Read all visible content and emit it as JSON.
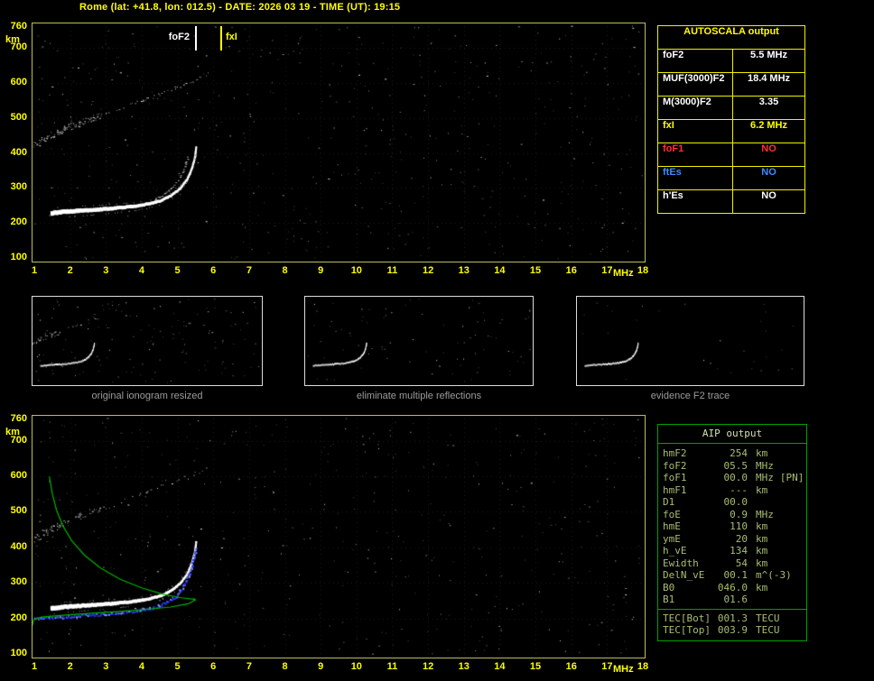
{
  "header": {
    "title": "Rome (lat: +41.8, lon: 012.5) - DATE: 2026 03 19 - TIME (UT): 19:15"
  },
  "colors": {
    "accent_yellow": "#ffff00",
    "plot_border": "#bdbd5a",
    "white": "#ffffff",
    "red": "#ff3030",
    "blue": "#3d8bff",
    "green": "#00b400",
    "aip_text": "#a9bd72",
    "caption_gray": "#9c9c9c"
  },
  "top_plot": {
    "y_unit": "km",
    "x_unit": "MHz",
    "y_ticks": [
      "760",
      "700",
      "600",
      "500",
      "400",
      "300",
      "200",
      "100"
    ],
    "x_ticks": [
      "1",
      "2",
      "3",
      "4",
      "5",
      "6",
      "7",
      "8",
      "9",
      "10",
      "11",
      "12",
      "13",
      "14",
      "15",
      "16",
      "17",
      "18"
    ],
    "markers": [
      {
        "label": "foF2",
        "freq": 5.5,
        "color": "#ffffff"
      },
      {
        "label": "fxI",
        "freq": 6.2,
        "color": "#ffff00"
      }
    ]
  },
  "bottom_plot": {
    "y_unit": "km",
    "x_unit": "MHz",
    "y_ticks": [
      "760",
      "700",
      "600",
      "500",
      "400",
      "300",
      "200",
      "100"
    ],
    "x_ticks": [
      "1",
      "2",
      "3",
      "4",
      "5",
      "6",
      "7",
      "8",
      "9",
      "10",
      "11",
      "12",
      "13",
      "14",
      "15",
      "16",
      "17",
      "18"
    ]
  },
  "autoscala": {
    "title": "AUTOSCALA output",
    "rows": [
      {
        "param": "foF2",
        "value": "5.5 MHz",
        "color": "#ffffff"
      },
      {
        "param": "MUF(3000)F2",
        "value": "18.4 MHz",
        "color": "#ffffff"
      },
      {
        "param": "M(3000)F2",
        "value": "3.35",
        "color": "#ffffff"
      },
      {
        "param": "fxI",
        "value": "6.2 MHz",
        "color": "#ffff00"
      },
      {
        "param": "foF1",
        "value": "NO",
        "color": "#ff3030"
      },
      {
        "param": "ftEs",
        "value": "NO",
        "color": "#3d8bff"
      },
      {
        "param": "h'Es",
        "value": "NO",
        "color": "#ffffff"
      }
    ]
  },
  "thumbnails": [
    {
      "caption": "original ionogram resized"
    },
    {
      "caption": "eliminate multiple reflections"
    },
    {
      "caption": "evidence F2 trace"
    }
  ],
  "aip": {
    "title": "AIP output",
    "rows": [
      {
        "param": "hmF2",
        "value": "254",
        "unit": "km"
      },
      {
        "param": "foF2",
        "value": "05.5",
        "unit": "MHz"
      },
      {
        "param": "foF1",
        "value": "00.0",
        "unit": "MHz",
        "note": "[PN]"
      },
      {
        "param": "hmF1",
        "value": "---",
        "unit": "km"
      },
      {
        "param": "D1",
        "value": "00.0",
        "unit": ""
      },
      {
        "param": "foE",
        "value": "0.9",
        "unit": "MHz"
      },
      {
        "param": "hmE",
        "value": "110",
        "unit": "km"
      },
      {
        "param": "ymE",
        "value": "20",
        "unit": "km"
      },
      {
        "param": "h_vE",
        "value": "134",
        "unit": "km"
      },
      {
        "param": "Ewidth",
        "value": "54",
        "unit": "km"
      },
      {
        "param": "DelN_vE",
        "value": "00.1",
        "unit": "m^(-3)"
      },
      {
        "param": "B0",
        "value": "046.0",
        "unit": "km"
      },
      {
        "param": "B1",
        "value": "01.6",
        "unit": ""
      }
    ],
    "tec_rows": [
      {
        "param": "TEC[Bot]",
        "value": "001.3",
        "unit": "TECU"
      },
      {
        "param": "TEC[Top]",
        "value": "003.9",
        "unit": "TECU"
      }
    ]
  },
  "chart_data": [
    {
      "id": "top_ionogram",
      "type": "scatter",
      "title": "ionogram with AUTOSCALA markers",
      "xlabel": "MHz",
      "ylabel": "km",
      "xlim": [
        1,
        18
      ],
      "ylim": [
        100,
        760
      ],
      "grid": true,
      "annotations": [
        {
          "label": "foF2",
          "x": 5.5
        },
        {
          "label": "fxI",
          "x": 6.2
        }
      ],
      "series": [
        {
          "name": "F2_trace",
          "points": [
            [
              1.45,
              228
            ],
            [
              1.8,
              232
            ],
            [
              2.2,
              235
            ],
            [
              2.7,
              238
            ],
            [
              3.2,
              242
            ],
            [
              3.7,
              247
            ],
            [
              4.1,
              253
            ],
            [
              4.5,
              263
            ],
            [
              4.8,
              278
            ],
            [
              5.05,
              298
            ],
            [
              5.25,
              325
            ],
            [
              5.38,
              355
            ],
            [
              5.47,
              390
            ],
            [
              5.5,
              418
            ]
          ]
        },
        {
          "name": "second_reflection_band",
          "points": [
            [
              1.0,
              425
            ],
            [
              1.4,
              448
            ],
            [
              1.9,
              472
            ],
            [
              2.4,
              492
            ],
            [
              2.9,
              510
            ],
            [
              3.4,
              528
            ],
            [
              3.9,
              547
            ],
            [
              4.4,
              566
            ],
            [
              4.9,
              584
            ],
            [
              5.3,
              600
            ],
            [
              5.65,
              615
            ],
            [
              5.85,
              628
            ]
          ]
        },
        {
          "name": "x_mode_branch",
          "points": [
            [
              4.35,
              268
            ],
            [
              4.65,
              285
            ],
            [
              4.9,
              307
            ],
            [
              5.08,
              333
            ],
            [
              5.2,
              362
            ],
            [
              5.3,
              395
            ]
          ]
        }
      ]
    },
    {
      "id": "bottom_ionogram_profile",
      "type": "line",
      "title": "ionogram with restored trace and electron density profile",
      "xlabel": "MHz",
      "ylabel": "km",
      "xlim": [
        1,
        18
      ],
      "ylim": [
        100,
        760
      ],
      "grid": true,
      "series": [
        {
          "name": "F2_trace",
          "points": [
            [
              1.45,
              228
            ],
            [
              1.8,
              232
            ],
            [
              2.2,
              235
            ],
            [
              2.7,
              238
            ],
            [
              3.2,
              242
            ],
            [
              3.7,
              247
            ],
            [
              4.1,
              253
            ],
            [
              4.5,
              263
            ],
            [
              4.8,
              278
            ],
            [
              5.05,
              298
            ],
            [
              5.25,
              325
            ],
            [
              5.38,
              355
            ],
            [
              5.47,
              390
            ],
            [
              5.5,
              418
            ]
          ]
        },
        {
          "name": "second_reflection_band",
          "points": [
            [
              1.0,
              425
            ],
            [
              1.4,
              448
            ],
            [
              1.9,
              472
            ],
            [
              2.4,
              492
            ],
            [
              2.9,
              510
            ],
            [
              3.4,
              528
            ],
            [
              3.9,
              547
            ],
            [
              4.4,
              566
            ],
            [
              4.9,
              584
            ],
            [
              5.3,
              600
            ],
            [
              5.65,
              615
            ],
            [
              5.85,
              628
            ]
          ]
        },
        {
          "name": "restored_trace_blue",
          "points": [
            [
              1.0,
              202
            ],
            [
              1.5,
              204
            ],
            [
              2.0,
              207
            ],
            [
              2.5,
              210
            ],
            [
              3.0,
              214
            ],
            [
              3.5,
              218
            ],
            [
              3.9,
              224
            ],
            [
              4.3,
              232
            ],
            [
              4.65,
              245
            ],
            [
              4.95,
              265
            ],
            [
              5.18,
              295
            ],
            [
              5.33,
              330
            ],
            [
              5.44,
              365
            ],
            [
              5.5,
              400
            ]
          ]
        },
        {
          "name": "electron_density_profile_green",
          "points": [
            [
              1.42,
              600
            ],
            [
              1.5,
              552
            ],
            [
              1.62,
              505
            ],
            [
              1.8,
              460
            ],
            [
              2.05,
              418
            ],
            [
              2.4,
              378
            ],
            [
              2.85,
              342
            ],
            [
              3.4,
              310
            ],
            [
              4.0,
              286
            ],
            [
              4.6,
              268
            ],
            [
              5.1,
              258
            ],
            [
              5.45,
              254
            ],
            [
              5.5,
              252
            ],
            [
              5.3,
              241
            ],
            [
              4.8,
              232
            ],
            [
              4.1,
              225
            ],
            [
              3.3,
              219
            ],
            [
              2.5,
              214
            ],
            [
              1.8,
              209
            ],
            [
              1.2,
              204
            ],
            [
              0.98,
              196
            ],
            [
              0.92,
              170
            ],
            [
              0.88,
              130
            ]
          ]
        }
      ]
    }
  ]
}
